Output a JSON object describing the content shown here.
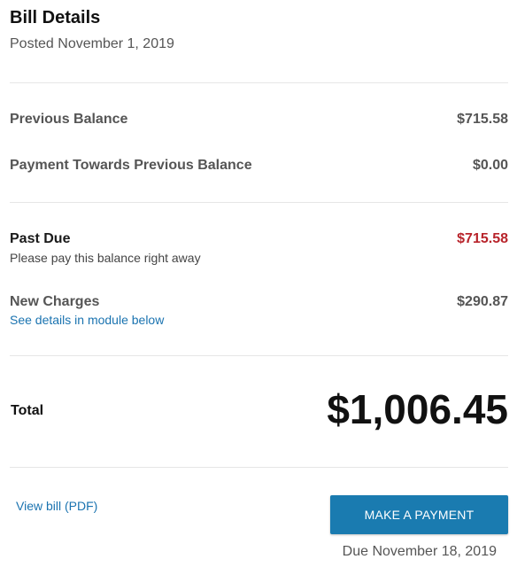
{
  "header": {
    "title": "Bill Details",
    "posted": "Posted November 1, 2019"
  },
  "rows": {
    "previous_balance": {
      "label": "Previous Balance",
      "amount": "$715.58"
    },
    "payment_towards": {
      "label": "Payment Towards Previous Balance",
      "amount": "$0.00"
    },
    "past_due": {
      "label": "Past Due",
      "amount": "$715.58",
      "note": "Please pay this balance right away",
      "amount_color": "#b8242b"
    },
    "new_charges": {
      "label": "New Charges",
      "amount": "$290.87",
      "link": "See details in module below"
    }
  },
  "total": {
    "label": "Total",
    "amount": "$1,006.45"
  },
  "footer": {
    "view_bill_link": "View bill (PDF)",
    "pay_button": "MAKE A PAYMENT",
    "due": "Due November 18, 2019",
    "button_color": "#1a7bb0",
    "link_color": "#1a73b0"
  }
}
